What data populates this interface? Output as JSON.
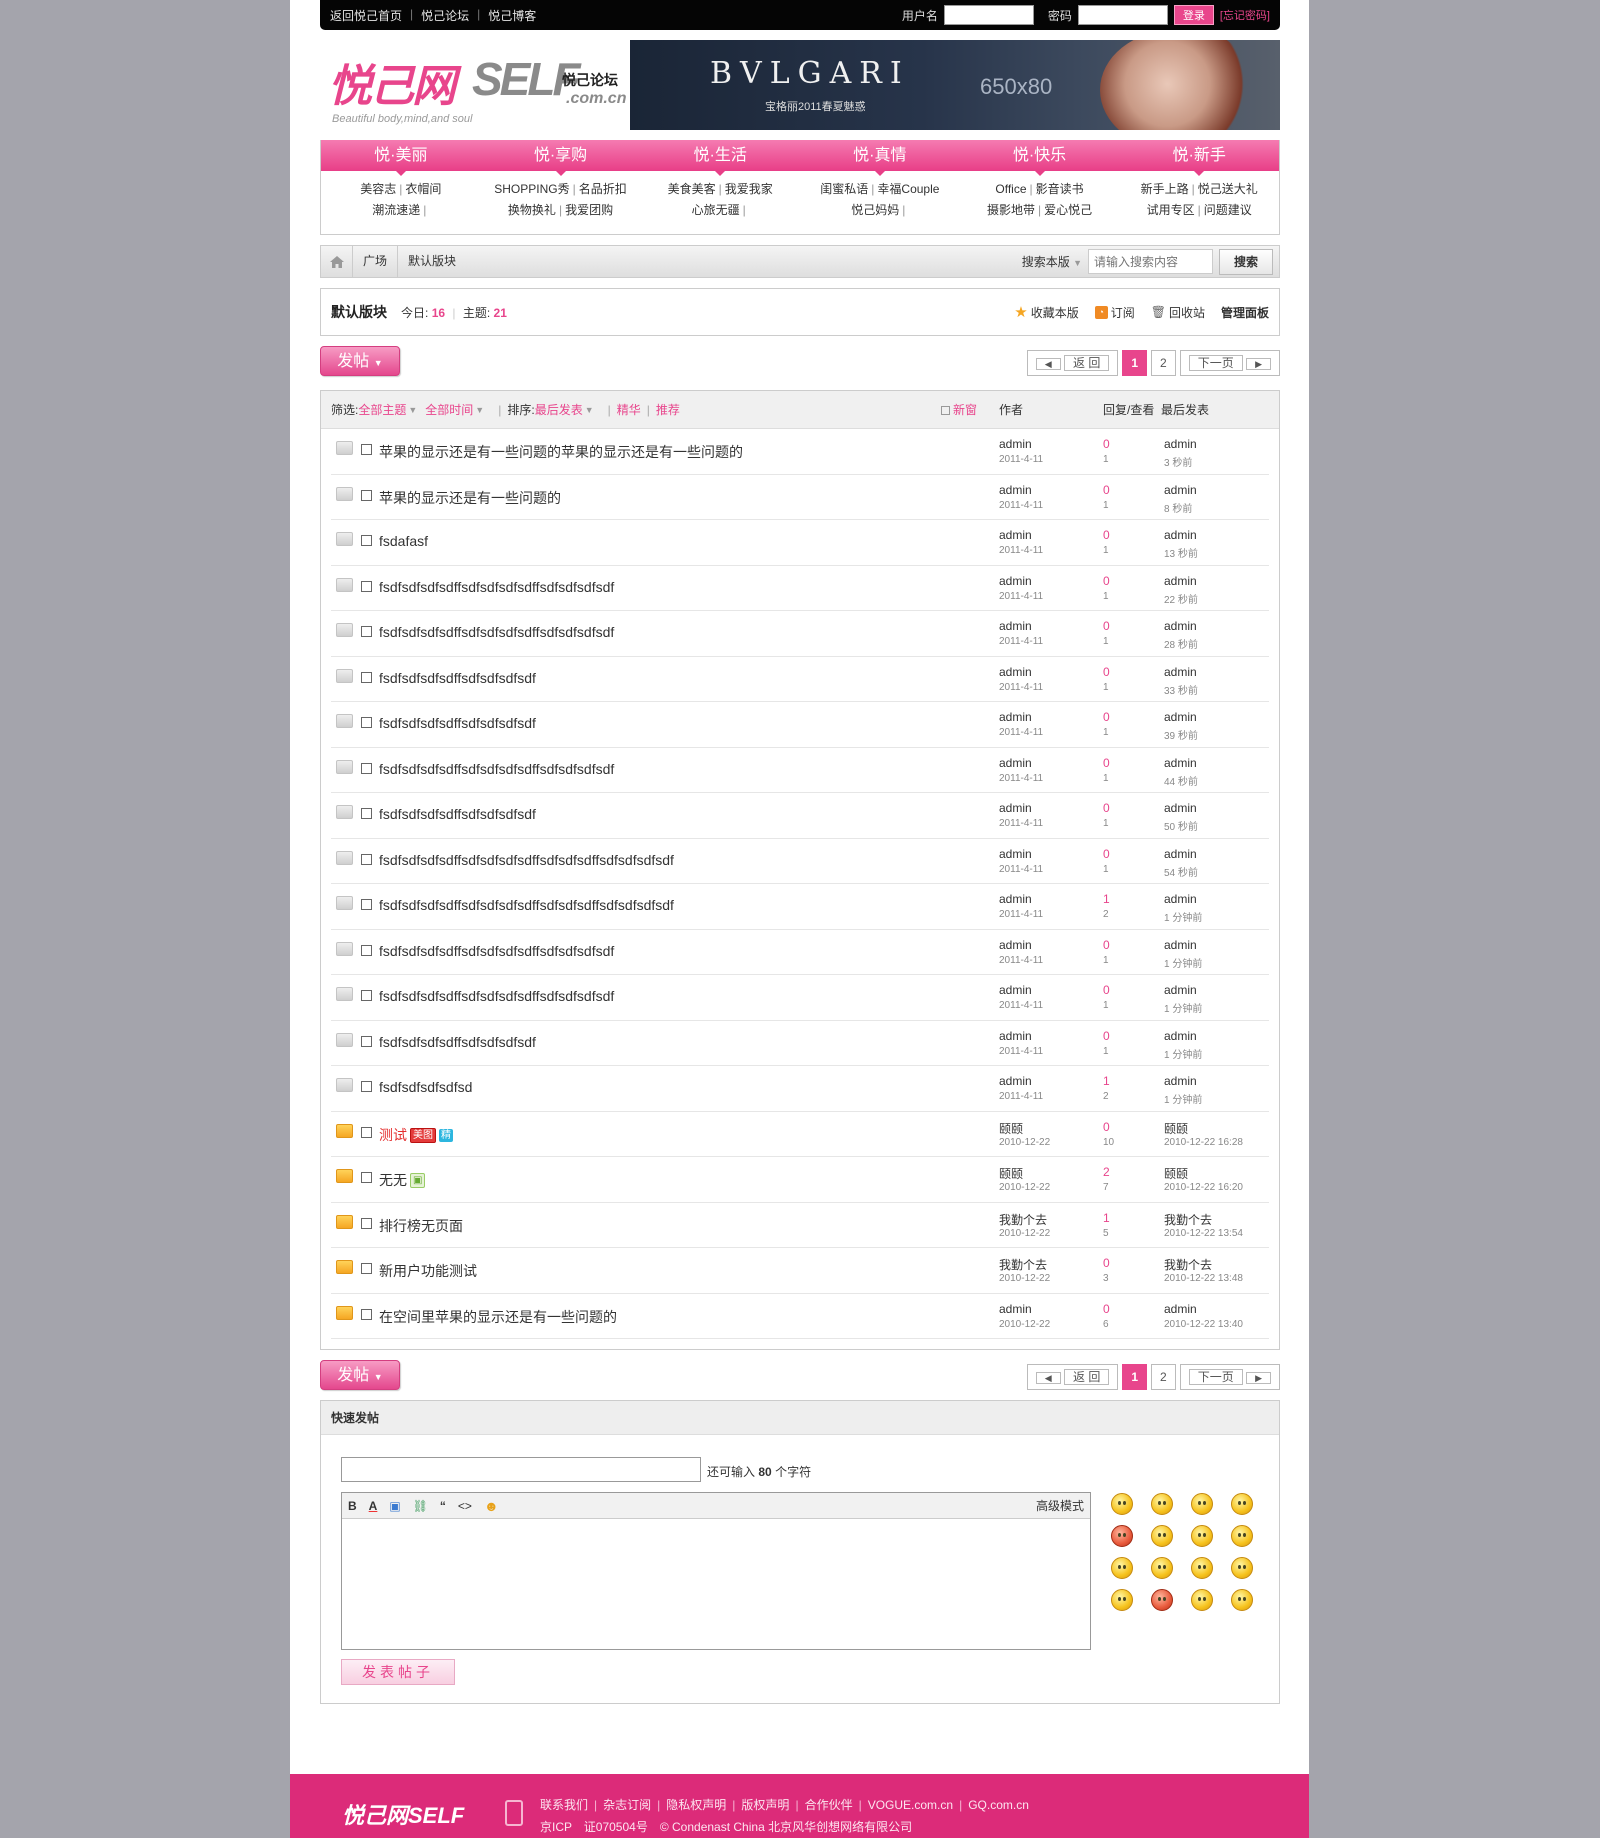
{
  "topbar": {
    "links": [
      "返回悦己首页",
      "悦己论坛",
      "悦己博客"
    ],
    "username_label": "用户名",
    "password_label": "密码",
    "login_button": "登录",
    "forgot_link": "[忘记密码]"
  },
  "header": {
    "logo_zh": "悦己网",
    "logo_en": "SELF",
    "logo_forum": "悦己论坛",
    "logo_domain": ".com.cn",
    "tagline": "Beautiful body,mind,and soul",
    "banner_brand": "BVLGARI",
    "banner_sub": "宝格丽2011春夏魅惑",
    "banner_size": "650x80"
  },
  "nav": {
    "tabs": [
      "悦·美丽",
      "悦·享购",
      "悦·生活",
      "悦·真情",
      "悦·快乐",
      "悦·新手"
    ],
    "cols": [
      [
        [
          "美容志",
          "衣帽间"
        ],
        [
          "潮流速递"
        ]
      ],
      [
        [
          "SHOPPING秀",
          "名品折扣"
        ],
        [
          "换物换礼",
          "我爱团购"
        ]
      ],
      [
        [
          "美食美客",
          "我爱我家"
        ],
        [
          "心旅无疆"
        ]
      ],
      [
        [
          "闺蜜私语",
          "幸福Couple"
        ],
        [
          "悦己妈妈"
        ]
      ],
      [
        [
          "Office",
          "影音读书"
        ],
        [
          "摄影地带",
          "爱心悦己"
        ]
      ],
      [
        [
          "新手上路",
          "悦己送大礼"
        ],
        [
          "试用专区",
          "问题建议"
        ]
      ]
    ]
  },
  "breadcrumb": {
    "items": [
      "广场",
      "默认版块"
    ],
    "search_scope": "搜索本版",
    "search_placeholder": "请输入搜索内容",
    "search_button": "搜索"
  },
  "forum": {
    "name": "默认版块",
    "today_label": "今日:",
    "today_value": "16",
    "topics_label": "主题:",
    "topics_value": "21",
    "actions": [
      "收藏本版",
      "订阅",
      "回收站",
      "管理面板"
    ]
  },
  "controls": {
    "post_button": "发帖",
    "pager_back": "返 回",
    "pages": [
      "1",
      "2"
    ],
    "pager_next": "下一页"
  },
  "table": {
    "filter_label": "筛选:",
    "filter_all": "全部主题",
    "filter_time": "全部时间",
    "sort_label": "排序:",
    "sort_value": "最后发表",
    "digest": "精华",
    "recommend": "推荐",
    "new_window": "新窗",
    "col_author": "作者",
    "col_replies": "回复/查看",
    "col_last": "最后发表"
  },
  "threads": [
    {
      "title": "苹果的显示还是有一些问题的苹果的显示还是有一些问题的",
      "author": "admin",
      "date": "2011-4-11",
      "replies": "0",
      "views": "1",
      "last_user": "admin",
      "last_time": "3 秒前",
      "icon": "gray",
      "red": false,
      "badges": []
    },
    {
      "title": "苹果的显示还是有一些问题的",
      "author": "admin",
      "date": "2011-4-11",
      "replies": "0",
      "views": "1",
      "last_user": "admin",
      "last_time": "8 秒前",
      "icon": "gray",
      "red": false,
      "badges": []
    },
    {
      "title": "fsdafasf",
      "author": "admin",
      "date": "2011-4-11",
      "replies": "0",
      "views": "1",
      "last_user": "admin",
      "last_time": "13 秒前",
      "icon": "gray",
      "red": false,
      "badges": []
    },
    {
      "title": "fsdfsdfsdfsdffsdfsdfsdfsdffsdfsdfsdfsdf",
      "author": "admin",
      "date": "2011-4-11",
      "replies": "0",
      "views": "1",
      "last_user": "admin",
      "last_time": "22 秒前",
      "icon": "gray",
      "red": false,
      "badges": []
    },
    {
      "title": "fsdfsdfsdfsdffsdfsdfsdfsdffsdfsdfsdfsdf",
      "author": "admin",
      "date": "2011-4-11",
      "replies": "0",
      "views": "1",
      "last_user": "admin",
      "last_time": "28 秒前",
      "icon": "gray",
      "red": false,
      "badges": []
    },
    {
      "title": "fsdfsdfsdfsdffsdfsdfsdfsdf",
      "author": "admin",
      "date": "2011-4-11",
      "replies": "0",
      "views": "1",
      "last_user": "admin",
      "last_time": "33 秒前",
      "icon": "gray",
      "red": false,
      "badges": []
    },
    {
      "title": "fsdfsdfsdfsdffsdfsdfsdfsdf",
      "author": "admin",
      "date": "2011-4-11",
      "replies": "0",
      "views": "1",
      "last_user": "admin",
      "last_time": "39 秒前",
      "icon": "gray",
      "red": false,
      "badges": []
    },
    {
      "title": "fsdfsdfsdfsdffsdfsdfsdfsdffsdfsdfsdfsdf",
      "author": "admin",
      "date": "2011-4-11",
      "replies": "0",
      "views": "1",
      "last_user": "admin",
      "last_time": "44 秒前",
      "icon": "gray",
      "red": false,
      "badges": []
    },
    {
      "title": "fsdfsdfsdfsdffsdfsdfsdfsdf",
      "author": "admin",
      "date": "2011-4-11",
      "replies": "0",
      "views": "1",
      "last_user": "admin",
      "last_time": "50 秒前",
      "icon": "gray",
      "red": false,
      "badges": []
    },
    {
      "title": "fsdfsdfsdfsdffsdfsdfsdfsdffsdfsdfsdffsdfsdfsdfsdf",
      "author": "admin",
      "date": "2011-4-11",
      "replies": "0",
      "views": "1",
      "last_user": "admin",
      "last_time": "54 秒前",
      "icon": "gray",
      "red": false,
      "badges": []
    },
    {
      "title": "fsdfsdfsdfsdffsdfsdfsdfsdffsdfsdfsdffsdfsdfsdfsdf",
      "author": "admin",
      "date": "2011-4-11",
      "replies": "1",
      "views": "2",
      "last_user": "admin",
      "last_time": "1 分钟前",
      "icon": "gray",
      "red": false,
      "badges": []
    },
    {
      "title": "fsdfsdfsdfsdffsdfsdfsdfsdffsdfsdfsdfsdf",
      "author": "admin",
      "date": "2011-4-11",
      "replies": "0",
      "views": "1",
      "last_user": "admin",
      "last_time": "1 分钟前",
      "icon": "gray",
      "red": false,
      "badges": []
    },
    {
      "title": "fsdfsdfsdfsdffsdfsdfsdfsdffsdfsdfsdfsdf",
      "author": "admin",
      "date": "2011-4-11",
      "replies": "0",
      "views": "1",
      "last_user": "admin",
      "last_time": "1 分钟前",
      "icon": "gray",
      "red": false,
      "badges": []
    },
    {
      "title": "fsdfsdfsdfsdffsdfsdfsdfsdf",
      "author": "admin",
      "date": "2011-4-11",
      "replies": "0",
      "views": "1",
      "last_user": "admin",
      "last_time": "1 分钟前",
      "icon": "gray",
      "red": false,
      "badges": []
    },
    {
      "title": "fsdfsdfsdfsdfsd",
      "author": "admin",
      "date": "2011-4-11",
      "replies": "1",
      "views": "2",
      "last_user": "admin",
      "last_time": "1 分钟前",
      "icon": "gray",
      "red": false,
      "badges": []
    },
    {
      "title": "测试",
      "author": "颐颐",
      "date": "2010-12-22",
      "replies": "0",
      "views": "10",
      "last_user": "颐颐",
      "last_time": "2010-12-22 16:28",
      "icon": "fold",
      "red": true,
      "badges": [
        {
          "text": "美图",
          "cls": "b-red"
        },
        {
          "text": "精",
          "cls": "b-cyan"
        }
      ]
    },
    {
      "title": "无无",
      "author": "颐颐",
      "date": "2010-12-22",
      "replies": "2",
      "views": "7",
      "last_user": "颐颐",
      "last_time": "2010-12-22 16:20",
      "icon": "fold",
      "red": false,
      "badges": [
        {
          "text": "▣",
          "cls": "b-img"
        }
      ]
    },
    {
      "title": "排行榜无页面",
      "author": "我勤个去",
      "date": "2010-12-22",
      "replies": "1",
      "views": "5",
      "last_user": "我勤个去",
      "last_time": "2010-12-22 13:54",
      "icon": "fold",
      "red": false,
      "badges": []
    },
    {
      "title": "新用户功能测试",
      "author": "我勤个去",
      "date": "2010-12-22",
      "replies": "0",
      "views": "3",
      "last_user": "我勤个去",
      "last_time": "2010-12-22 13:48",
      "icon": "fold",
      "red": false,
      "badges": []
    },
    {
      "title": "在空间里苹果的显示还是有一些问题的",
      "author": "admin",
      "date": "2010-12-22",
      "replies": "0",
      "views": "6",
      "last_user": "admin",
      "last_time": "2010-12-22 13:40",
      "icon": "fold",
      "red": false,
      "badges": []
    }
  ],
  "quick": {
    "title": "快速发帖",
    "remain_prefix": "还可输入",
    "remain_count": "80",
    "remain_suffix": "个字符",
    "toolbar": [
      "B",
      "A",
      "▣",
      "⛓",
      "“",
      "<>",
      "☻"
    ],
    "advanced": "高级模式",
    "submit": "发表帖子",
    "smilies": 16
  },
  "footer": {
    "logo": "悦己网SELF",
    "links": [
      "联系我们",
      "杂志订阅",
      "隐私权声明",
      "版权声明",
      "合作伙伴",
      "VOGUE.com.cn",
      "GQ.com.cn"
    ],
    "copyright": "京ICP　证070504号　© Condenast China 北京风华创想网络有限公司"
  },
  "colors": {
    "accent": "#e8458c",
    "footer": "#dc2b79",
    "background": "#a4a4ac"
  }
}
